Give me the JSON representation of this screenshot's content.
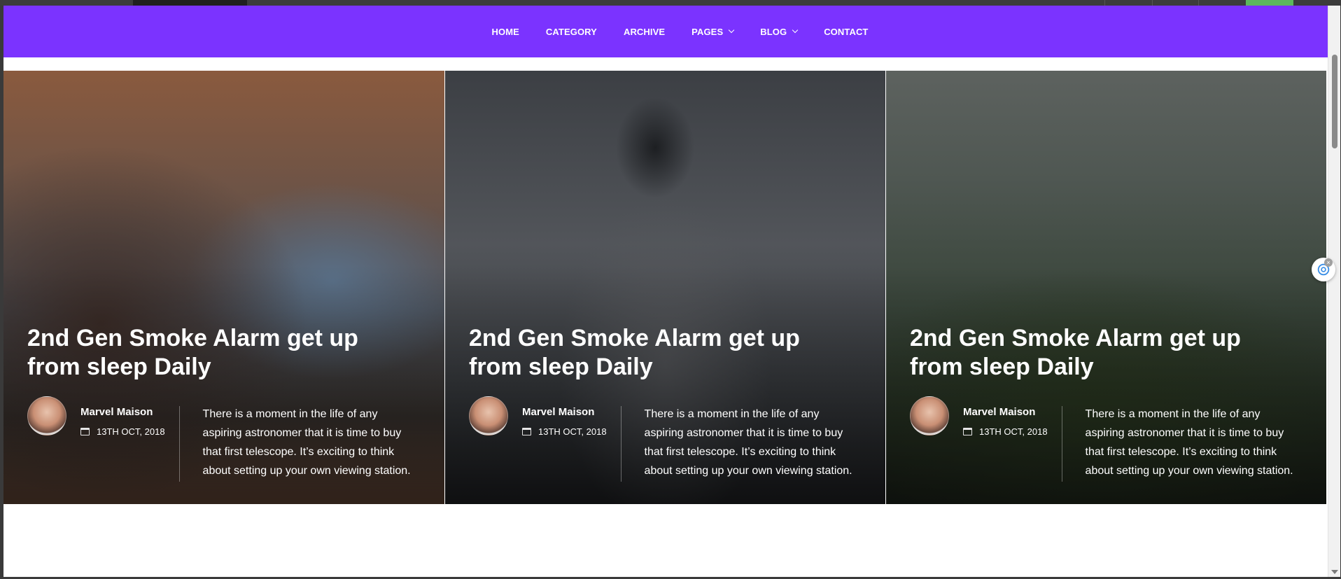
{
  "nav": {
    "items": [
      {
        "label": "HOME",
        "dropdown": false
      },
      {
        "label": "CATEGORY",
        "dropdown": false
      },
      {
        "label": "ARCHIVE",
        "dropdown": false
      },
      {
        "label": "PAGES",
        "dropdown": true
      },
      {
        "label": "BLOG",
        "dropdown": true
      },
      {
        "label": "CONTACT",
        "dropdown": false
      }
    ],
    "background_color": "#7b33ff"
  },
  "posts": [
    {
      "title": "2nd Gen Smoke Alarm get up from sleep Daily",
      "author": "Marvel Maison",
      "date": "13TH OCT, 2018",
      "excerpt": "There is a moment in the life of any aspiring astronomer that it is time to buy that first telescope. It’s exciting to think about setting up your own viewing station.",
      "image_subject": "canyon-mountains"
    },
    {
      "title": "2nd Gen Smoke Alarm get up from sleep Daily",
      "author": "Marvel Maison",
      "date": "13TH OCT, 2018",
      "excerpt": "There is a moment in the life of any aspiring astronomer that it is time to buy that first telescope. It’s exciting to think about setting up your own viewing station.",
      "image_subject": "man-looking-away"
    },
    {
      "title": "2nd Gen Smoke Alarm get up from sleep Daily",
      "author": "Marvel Maison",
      "date": "13TH OCT, 2018",
      "excerpt": "There is a moment in the life of any aspiring astronomer that it is time to buy that first telescope. It’s exciting to think about setting up your own viewing station.",
      "image_subject": "misty-forest"
    }
  ],
  "icons": {
    "calendar": "calendar-icon",
    "chevron": "chevron-down-icon",
    "assistant": "chatgpt-icon"
  }
}
